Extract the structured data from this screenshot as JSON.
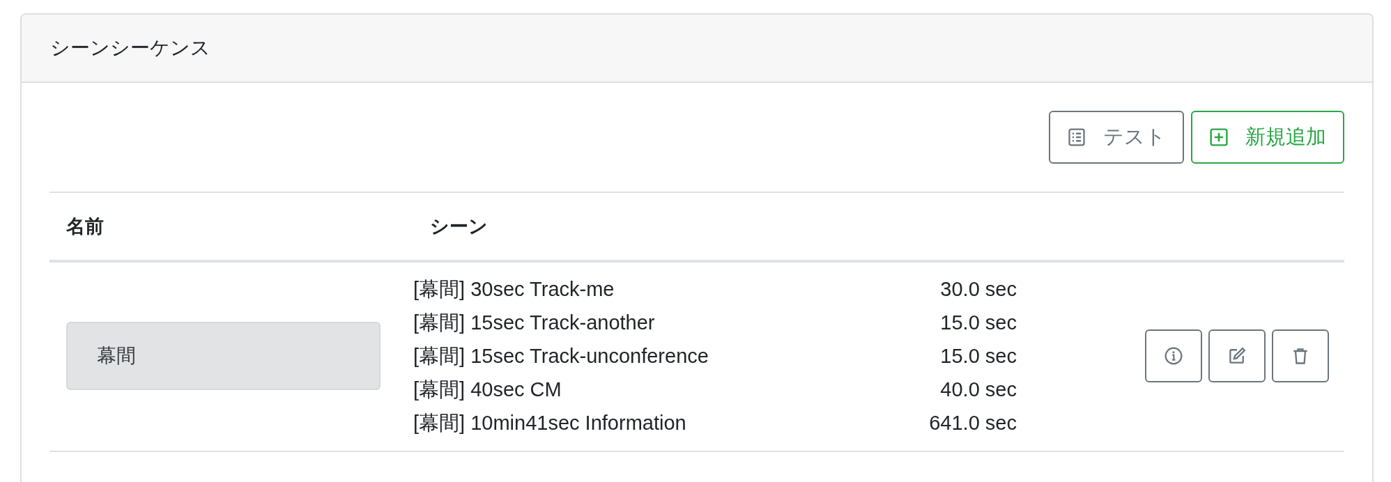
{
  "card": {
    "title": "シーンシーケンス"
  },
  "toolbar": [
    {
      "label": "テスト",
      "kind": "test"
    },
    {
      "label": "新規追加",
      "kind": "add"
    }
  ],
  "table": {
    "columns": [
      "名前",
      "シーン"
    ],
    "rows": [
      {
        "name": "幕間",
        "scenes": [
          {
            "title": "[幕間] 30sec Track-me",
            "duration": "30.0 sec"
          },
          {
            "title": "[幕間] 15sec Track-another",
            "duration": "15.0 sec"
          },
          {
            "title": "[幕間] 15sec Track-unconference",
            "duration": "15.0 sec"
          },
          {
            "title": "[幕間] 40sec CM",
            "duration": "40.0 sec"
          },
          {
            "title": "[幕間] 10min41sec Information",
            "duration": "641.0 sec"
          }
        ],
        "actions": [
          {
            "kind": "info"
          },
          {
            "kind": "edit"
          },
          {
            "kind": "delete"
          }
        ]
      }
    ]
  }
}
